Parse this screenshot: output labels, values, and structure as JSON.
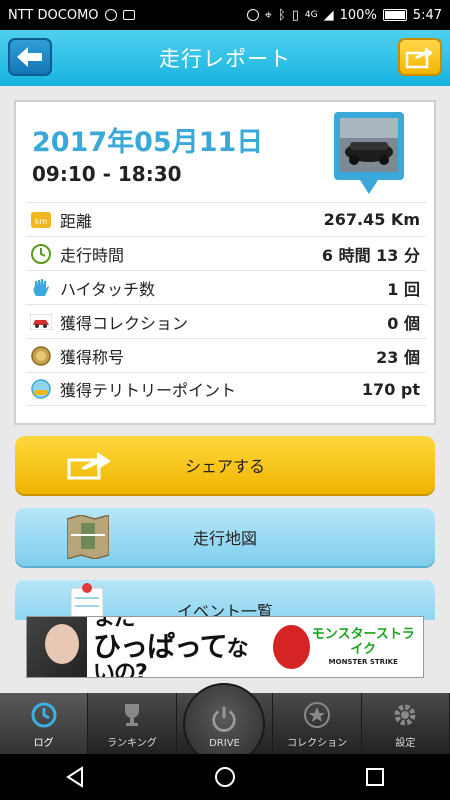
{
  "status_bar": {
    "carrier": "NTT DOCOMO",
    "battery": "100%",
    "time": "5:47",
    "network": "4G"
  },
  "header": {
    "title": "走行レポート",
    "back_icon": "arrow-left-icon",
    "share_icon": "share-icon"
  },
  "report": {
    "date": "2017年05月11日",
    "time_range": "09:10 - 18:30",
    "rows": [
      {
        "icon": "km-icon",
        "label": "距離",
        "value": "267.45 Km"
      },
      {
        "icon": "clock-icon",
        "label": "走行時間",
        "value": "6 時間 13 分"
      },
      {
        "icon": "hand-icon",
        "label": "ハイタッチ数",
        "value": "1 回"
      },
      {
        "icon": "car-icon",
        "label": "獲得コレクション",
        "value": "0 個"
      },
      {
        "icon": "medal-icon",
        "label": "獲得称号",
        "value": "23 個"
      },
      {
        "icon": "spot-icon",
        "label": "獲得テリトリーポイント",
        "value": "170 pt"
      }
    ]
  },
  "actions": {
    "share_label": "シェアする",
    "map_label": "走行地図",
    "event_label": "イベント一覧"
  },
  "ad": {
    "line1": "まだ",
    "line2": "ひっぱって",
    "line3": "ないの?",
    "logo": "モンスターストライク",
    "logo_sub": "MONSTER STRIKE"
  },
  "bottom_nav": {
    "items": [
      {
        "label": "ログ",
        "icon": "clock-icon"
      },
      {
        "label": "ランキング",
        "icon": "trophy-icon"
      },
      {
        "label": "DRIVE",
        "icon": "power-icon"
      },
      {
        "label": "コレクション",
        "icon": "star-icon"
      },
      {
        "label": "設定",
        "icon": "gear-icon"
      }
    ]
  },
  "colors": {
    "header": "#18b3e0",
    "date": "#3aa8d8",
    "share_button": "#f0b400",
    "map_button": "#7fcfee"
  }
}
